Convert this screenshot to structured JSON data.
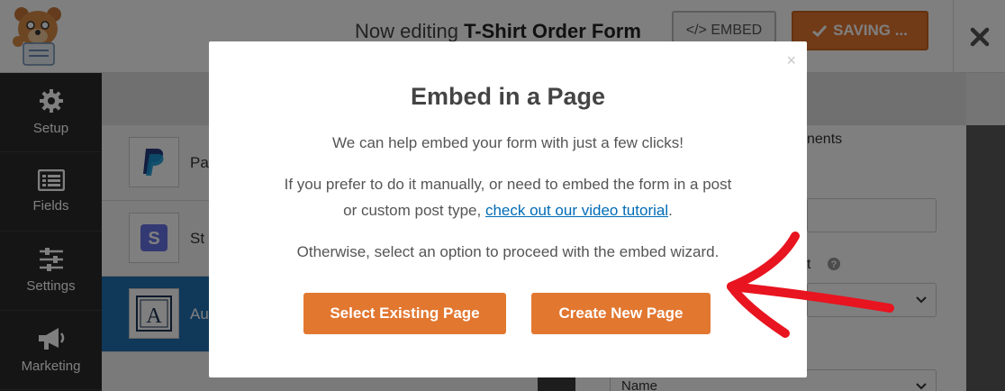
{
  "header": {
    "editing_prefix": "Now editing",
    "form_name": "T-Shirt Order Form",
    "embed_label": "</> EMBED",
    "saving_label": "SAVING ..."
  },
  "sidebar": {
    "items": [
      {
        "label": "Setup",
        "icon": "gear-icon"
      },
      {
        "label": "Fields",
        "icon": "list-icon"
      },
      {
        "label": "Settings",
        "icon": "sliders-icon"
      },
      {
        "label": "Marketing",
        "icon": "megaphone-icon"
      }
    ]
  },
  "field_list": {
    "items": [
      {
        "label": "Pa",
        "icon": "paypal-icon"
      },
      {
        "label": "St",
        "icon": "stripe-icon"
      },
      {
        "label": "Au",
        "icon": "authorize-net-icon"
      }
    ]
  },
  "options": {
    "partial_label": "nents",
    "partial_label_2": "t",
    "name_select_value": "Name"
  },
  "modal": {
    "close_glyph": "×",
    "title": "Embed in a Page",
    "line1": "We can help embed your form with just a few clicks!",
    "line2a": "If you prefer to do it manually, or need to embed the form in a post",
    "line2b_prefix": "or custom post type, ",
    "link_text": "check out our video tutorial",
    "line2b_suffix": ".",
    "line3": "Otherwise, select an option to proceed with the embed wizard.",
    "btn_existing": "Select Existing Page",
    "btn_new": "Create New Page"
  },
  "colors": {
    "accent": "#e27730",
    "link": "#006bb7",
    "sidebar_bg": "#2a2a2a",
    "active_row": "#2170b2",
    "arrow": "#e8141f"
  }
}
